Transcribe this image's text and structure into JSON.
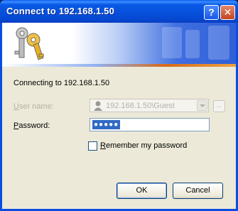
{
  "window": {
    "title": "Connect to 192.168.1.50",
    "help_glyph": "?",
    "close_glyph": "✕",
    "icons": {
      "banner": "keys-icon",
      "help": "help-icon",
      "close": "close-icon"
    },
    "colors": {
      "titlebar": "#0650dc",
      "client": "#ece9d8",
      "selection": "#316ac5"
    }
  },
  "dialog": {
    "connecting_text": "Connecting to 192.168.1.50",
    "username_label_prefix": "U",
    "username_label_rest": "ser name:",
    "username_value": "192.168.1.50\\Guest",
    "username_disabled": true,
    "browse_label": "...",
    "password_label_prefix": "P",
    "password_label_rest": "assword:",
    "password_mask": "●●●●●",
    "remember_label_prefix": "R",
    "remember_label_rest": "emember my password",
    "remember_checked": false,
    "ok_label": "OK",
    "cancel_label": "Cancel"
  }
}
